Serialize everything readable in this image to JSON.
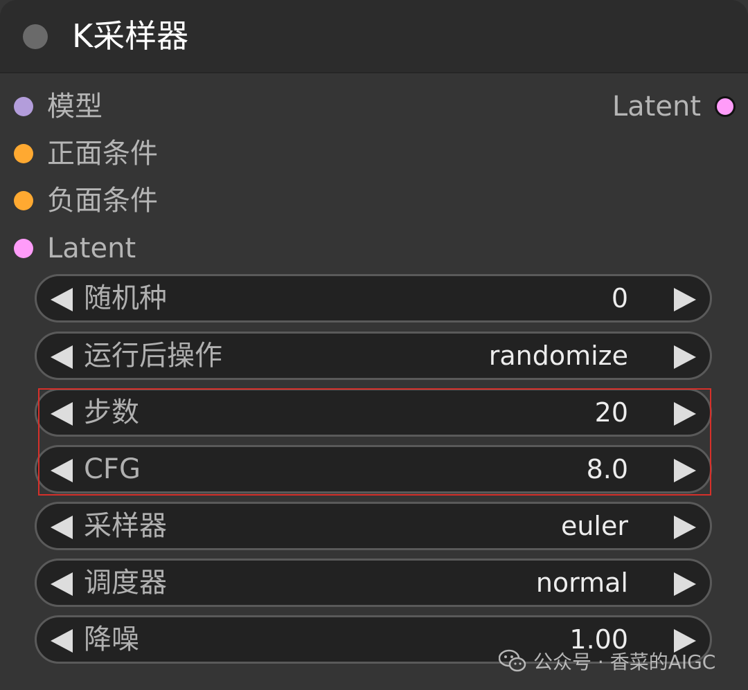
{
  "node": {
    "title": "K采样器",
    "colors": {
      "title_dot": "#6a6a6a",
      "model_dot": "#b39ddb",
      "conditioning_dot": "#ffa931",
      "latent_dot": "#ff9cf9",
      "highlight": "#d6302a"
    }
  },
  "inputs": [
    {
      "label": "模型",
      "color": "#b39ddb"
    },
    {
      "label": "正面条件",
      "color": "#ffa931"
    },
    {
      "label": "负面条件",
      "color": "#ffa931"
    },
    {
      "label": "Latent",
      "color": "#ff9cf9"
    }
  ],
  "outputs": [
    {
      "label": "Latent",
      "color": "#ff9cf9"
    }
  ],
  "widgets": [
    {
      "label": "随机种",
      "value": "0"
    },
    {
      "label": "运行后操作",
      "value": "randomize"
    },
    {
      "label": "步数",
      "value": "20"
    },
    {
      "label": "CFG",
      "value": "8.0"
    },
    {
      "label": "采样器",
      "value": "euler"
    },
    {
      "label": "调度器",
      "value": "normal"
    },
    {
      "label": "降噪",
      "value": "1.00"
    }
  ],
  "watermark": {
    "text": "公众号 · 香菜的AIGC",
    "icon": "wechat-icon"
  }
}
